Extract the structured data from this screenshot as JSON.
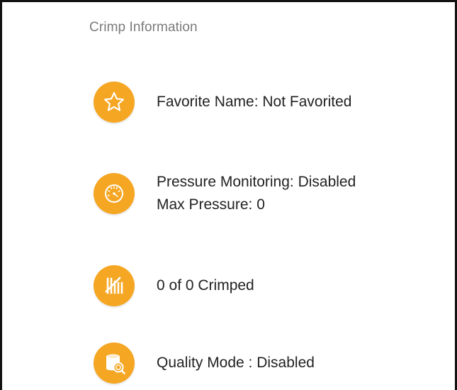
{
  "section": {
    "title": "Crimp Information"
  },
  "colors": {
    "accent": "#f5a623",
    "text": "#222222",
    "muted": "#7a7a7a"
  },
  "items": [
    {
      "icon": "star-icon",
      "lines": [
        "Favorite Name: Not Favorited"
      ]
    },
    {
      "icon": "gauge-icon",
      "lines": [
        "Pressure Monitoring: Disabled",
        "Max Pressure: 0"
      ]
    },
    {
      "icon": "tally-icon",
      "lines": [
        "0 of 0 Crimped"
      ]
    },
    {
      "icon": "quality-search-icon",
      "lines": [
        "Quality Mode : Disabled"
      ]
    }
  ]
}
